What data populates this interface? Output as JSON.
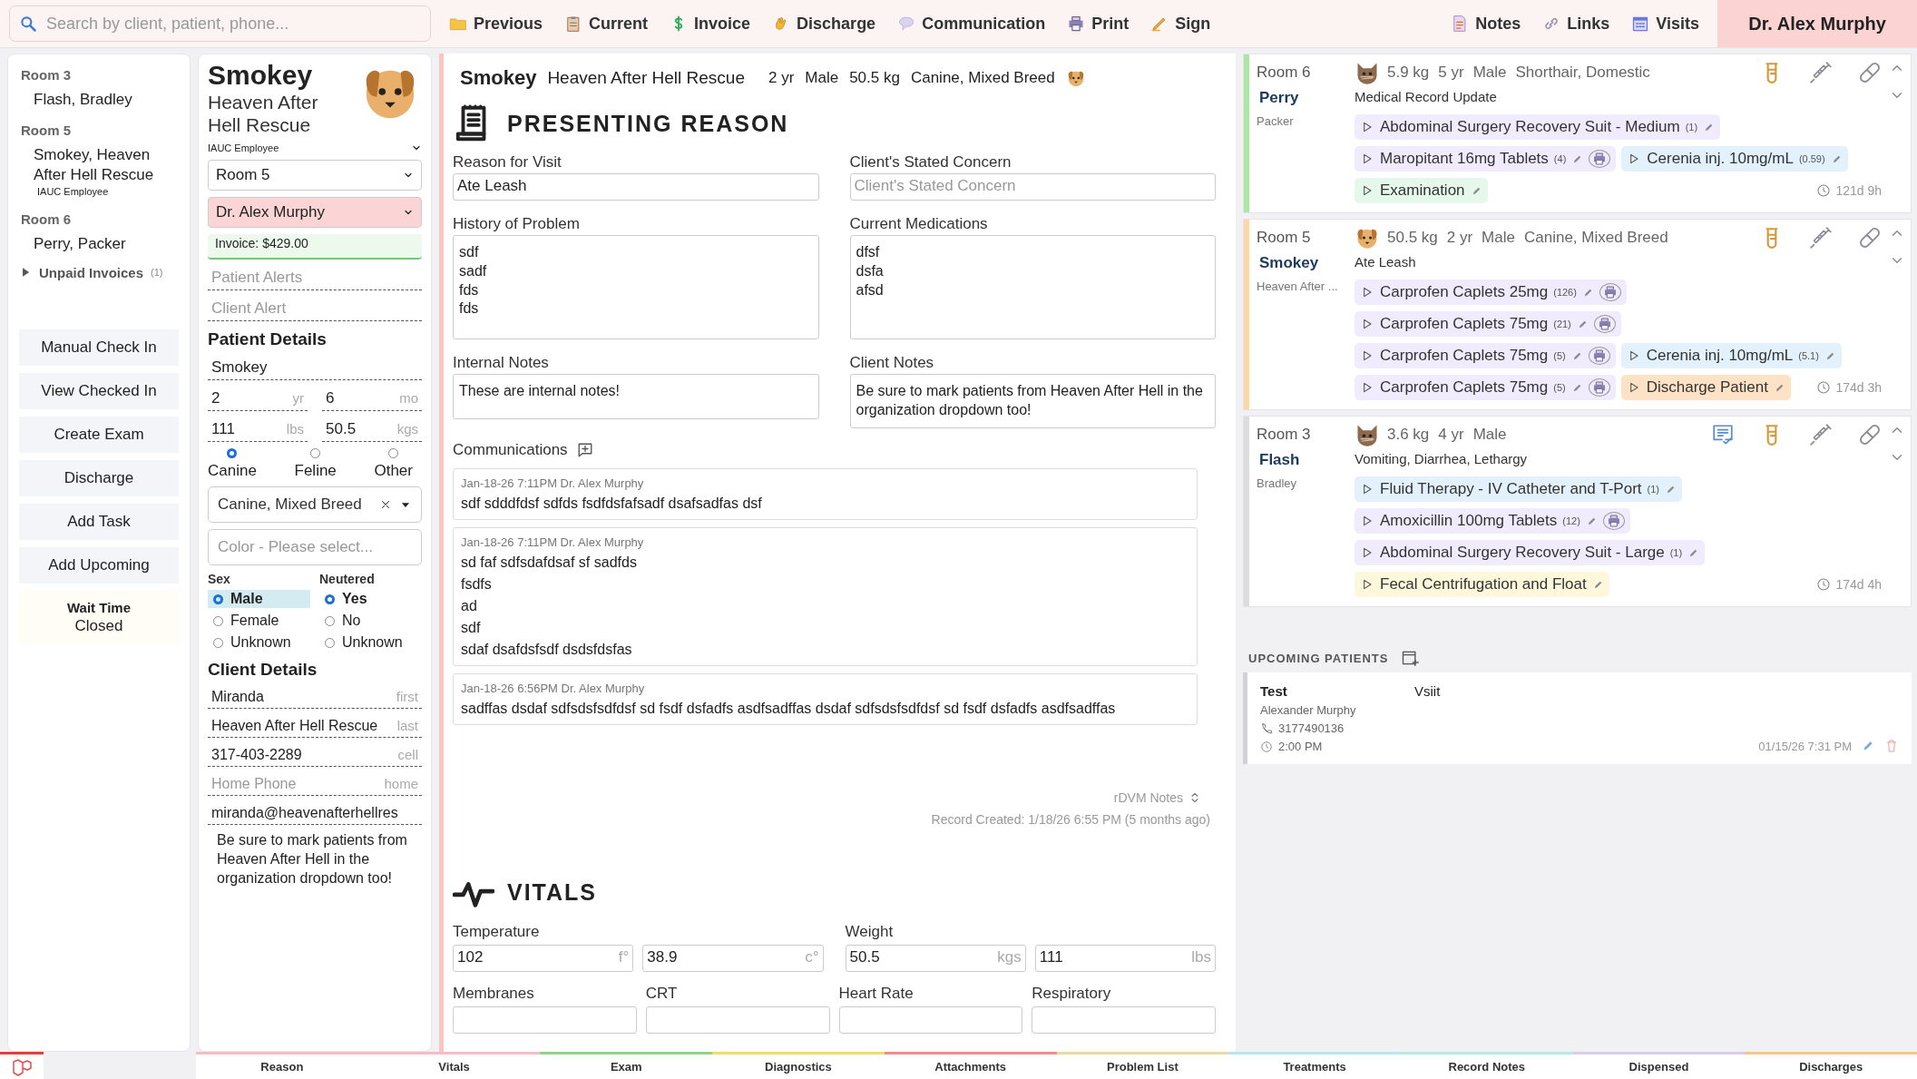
{
  "toolbar": {
    "search_placeholder": "Search by client, patient, phone...",
    "actions": [
      {
        "label": "Previous"
      },
      {
        "label": "Current"
      },
      {
        "label": "Invoice"
      },
      {
        "label": "Discharge"
      },
      {
        "label": "Communication"
      },
      {
        "label": "Print"
      },
      {
        "label": "Sign"
      }
    ],
    "links": [
      {
        "label": "Notes"
      },
      {
        "label": "Links"
      },
      {
        "label": "Visits"
      }
    ],
    "user": "Dr. Alex Murphy"
  },
  "sidebar": {
    "rooms": [
      {
        "room": "Room 3",
        "patient": "Flash, Bradley"
      },
      {
        "room": "Room 5",
        "patient": "Smokey, Heaven After Hell Rescue",
        "note": "IAUC Employee"
      },
      {
        "room": "Room 6",
        "patient": "Perry, Packer"
      }
    ],
    "unpaid": {
      "label": "Unpaid Invoices",
      "count": "(1)",
      "expanded": false
    },
    "buttons": [
      "Manual Check In",
      "View Checked In",
      "Create Exam",
      "Discharge",
      "Add Task",
      "Add Upcoming"
    ],
    "wait": {
      "label": "Wait Time",
      "value": "Closed"
    }
  },
  "patient": {
    "name": "Smokey",
    "org": "Heaven After Hell Rescue",
    "kind": "dog",
    "org_type": "IAUC Employee",
    "room": "Room 5",
    "doctor": "Dr. Alex Murphy",
    "invoice": "Invoice: $429.00",
    "alert_placeholders": [
      "Patient Alerts",
      "Client Alert"
    ],
    "details_title": "Patient Details",
    "pet_name": "Smokey",
    "age": [
      {
        "value": "2",
        "unit": "yr"
      },
      {
        "value": "6",
        "unit": "mo"
      }
    ],
    "weight": [
      {
        "value": "111",
        "unit": "lbs"
      },
      {
        "value": "50.5",
        "unit": "kgs"
      }
    ],
    "species": [
      {
        "label": "Canine",
        "selected": true
      },
      {
        "label": "Feline",
        "selected": false
      },
      {
        "label": "Other",
        "selected": false
      }
    ],
    "breed": "Canine, Mixed Breed",
    "color_placeholder": "Color - Please select...",
    "radio_groups": [
      {
        "label": "Sex",
        "options": [
          {
            "label": "Male",
            "selected": true,
            "focused": true
          },
          {
            "label": "Female",
            "selected": false,
            "focused": false
          },
          {
            "label": "Unknown",
            "selected": false,
            "focused": false
          }
        ]
      },
      {
        "label": "Neutered",
        "options": [
          {
            "label": "Yes",
            "selected": true,
            "focused": false
          },
          {
            "label": "No",
            "selected": false,
            "focused": false
          },
          {
            "label": "Unknown",
            "selected": false,
            "focused": false
          }
        ]
      }
    ],
    "client_title": "Client Details",
    "client_fields": [
      {
        "value": "Miranda",
        "unit": "first"
      },
      {
        "value": "Heaven After Hell Rescue",
        "unit": "last"
      },
      {
        "value": "317-403-2289",
        "unit": "cell"
      },
      {
        "placeholder": "Home Phone",
        "unit": "home"
      },
      {
        "value": "miranda@heavenafterhellres"
      }
    ],
    "notes": "Be sure to mark patients from Heaven After Hell in the organization dropdown too!"
  },
  "exam": {
    "name": "Smokey",
    "org": "Heaven After Hell Rescue",
    "facts": [
      "2 yr",
      "Male",
      "50.5 kg",
      "Canine, Mixed Breed"
    ],
    "kind": "dog",
    "title": "PRESENTING REASON",
    "fields": [
      {
        "kind": "input",
        "label": "Reason for Visit",
        "value": "Ate Leash"
      },
      {
        "kind": "input",
        "label": "Client's Stated Concern",
        "placeholder": "Client's Stated Concern"
      },
      {
        "kind": "lines",
        "label": "History of Problem",
        "lines": [
          "sdf",
          "sadf",
          "fds",
          "fds"
        ]
      },
      {
        "kind": "lines",
        "label": "Current Medications",
        "lines": [
          "dfsf",
          "dsfa",
          "afsd"
        ]
      },
      {
        "kind": "text",
        "label": "Internal Notes",
        "text": "These are internal notes!"
      },
      {
        "kind": "text",
        "label": "Client Notes",
        "text": "Be sure to mark patients from Heaven After Hell in the organization dropdown too!"
      }
    ],
    "communications": {
      "label": "Communications",
      "entries": [
        {
          "meta": "Jan-18-26 7:11PM Dr. Alex Murphy",
          "lines": [
            "sdf sdddfdsf sdfds fsdfdsfafsadf dsafsadfas dsf"
          ]
        },
        {
          "meta": "Jan-18-26 7:11PM Dr. Alex Murphy",
          "lines": [
            "sd faf sdfsdafdsaf sf sadfds",
            "fsdfs",
            "ad",
            "sdf",
            "sdaf dsafdsfsdf dsdsfdsfas"
          ]
        },
        {
          "meta": "Jan-18-26 6:56PM Dr. Alex Murphy",
          "lines": [
            "sadffas dsdaf sdfsdsfsdfdsf sd fsdf dsfadfs asdfsadffas dsdaf sdfsdsfsdfdsf sd fsdf dsfadfs asdfsadffas"
          ]
        }
      ]
    },
    "rdvm": "rDVM Notes",
    "created": "Record Created: 1/18/26 6:55 PM (5 months ago)",
    "vitals": {
      "title": "VITALS",
      "groups": [
        {
          "label": "Temperature",
          "inputs": [
            {
              "value": "102",
              "unit": "f°"
            },
            {
              "value": "38.9",
              "unit": "c°"
            }
          ]
        },
        {
          "label": "Weight",
          "inputs": [
            {
              "value": "50.5",
              "unit": "kgs"
            },
            {
              "value": "111",
              "unit": "lbs"
            }
          ]
        }
      ],
      "more": [
        "Membranes",
        "CRT",
        "Heart Rate",
        "Respiratory"
      ]
    }
  },
  "board": {
    "rooms": [
      {
        "room": "Room 6",
        "patient": "Perry",
        "client": "Packer",
        "color": "#a9e8a3",
        "kind": "cat",
        "facts": [
          "5.9 kg",
          "5 yr",
          "Male",
          "Shorthair, Domestic"
        ],
        "reason": "Medical Record Update",
        "checklist": false,
        "time": "121d 9h",
        "rows": [
          [
            {
              "label": "Abdominal Surgery Recovery Suit - Medium",
              "count": "(1)",
              "printable": false,
              "color": "#f0ecfd"
            }
          ],
          [
            {
              "label": "Maropitant 16mg Tablets",
              "count": "(4)",
              "printable": true,
              "color": "#f0ecfd"
            },
            {
              "label": "Cerenia inj. 10mg/mL",
              "count": "(0.59)",
              "printable": false,
              "color": "#e2f1fb"
            }
          ],
          [
            {
              "label": "Examination",
              "printable": false,
              "color": "#e6f8ec"
            }
          ]
        ]
      },
      {
        "room": "Room 5",
        "patient": "Smokey",
        "client": "Heaven After ...",
        "color": "#ffd6a6",
        "kind": "dog",
        "facts": [
          "50.5 kg",
          "2 yr",
          "Male",
          "Canine, Mixed Breed"
        ],
        "reason": "Ate Leash",
        "checklist": false,
        "time": "174d 3h",
        "rows": [
          [
            {
              "label": "Carprofen Caplets 25mg",
              "count": "(126)",
              "printable": true,
              "color": "#f0ecfd"
            }
          ],
          [
            {
              "label": "Carprofen Caplets 75mg",
              "count": "(21)",
              "printable": true,
              "color": "#f0ecfd"
            }
          ],
          [
            {
              "label": "Carprofen Caplets 75mg",
              "count": "(5)",
              "printable": true,
              "color": "#f0ecfd"
            },
            {
              "label": "Cerenia inj. 10mg/mL",
              "count": "(5.1)",
              "printable": false,
              "color": "#e2f1fb"
            }
          ],
          [
            {
              "label": "Carprofen Caplets 75mg",
              "count": "(5)",
              "printable": true,
              "color": "#f0ecfd"
            },
            {
              "label": "Discharge Patient",
              "printable": false,
              "color": "#fde2c6"
            }
          ]
        ]
      },
      {
        "room": "Room 3",
        "patient": "Flash",
        "client": "Bradley",
        "color": "#dcdcdc",
        "kind": "cat",
        "facts": [
          "3.6 kg",
          "4 yr",
          "Male"
        ],
        "reason": "Vomiting, Diarrhea, Lethargy",
        "checklist": true,
        "time": "174d 4h",
        "rows": [
          [
            {
              "label": "Fluid Therapy - IV Catheter and T-Port",
              "count": "(1)",
              "printable": false,
              "color": "#e2f1fb"
            }
          ],
          [
            {
              "label": "Amoxicillin 100mg Tablets",
              "count": "(12)",
              "printable": true,
              "color": "#f0ecfd"
            }
          ],
          [
            {
              "label": "Abdominal Surgery Recovery Suit - Large",
              "count": "(1)",
              "printable": false,
              "color": "#f0ecfd"
            }
          ],
          [
            {
              "label": "Fecal Centrifugation and Float",
              "printable": false,
              "color": "#fdf8dc"
            }
          ]
        ]
      }
    ],
    "upcoming": {
      "title": "UPCOMING PATIENTS",
      "entries": [
        {
          "name": "Test",
          "reason": "Vsiit",
          "doctor": "Alexander Murphy",
          "phone": "3177490136",
          "time": "2:00 PM",
          "created": "01/15/26 7:31 PM"
        }
      ]
    }
  },
  "bottom_tabs": [
    {
      "label": "Reason",
      "color": "#f7bcc4"
    },
    {
      "label": "Vitals",
      "color": "#f7bcc4"
    },
    {
      "label": "Exam",
      "color": "#8fd48a"
    },
    {
      "label": "Diagnostics",
      "color": "#eedd6a"
    },
    {
      "label": "Attachments",
      "color": "#f08c8c"
    },
    {
      "label": "Problem List",
      "color": "#ead9a6"
    },
    {
      "label": "Treatments",
      "color": "#b6e6f0"
    },
    {
      "label": "Record Notes",
      "color": "#b9e9e6"
    },
    {
      "label": "Dispensed",
      "color": "#d6cdf0"
    },
    {
      "label": "Discharges",
      "color": "#f7c58a"
    }
  ]
}
